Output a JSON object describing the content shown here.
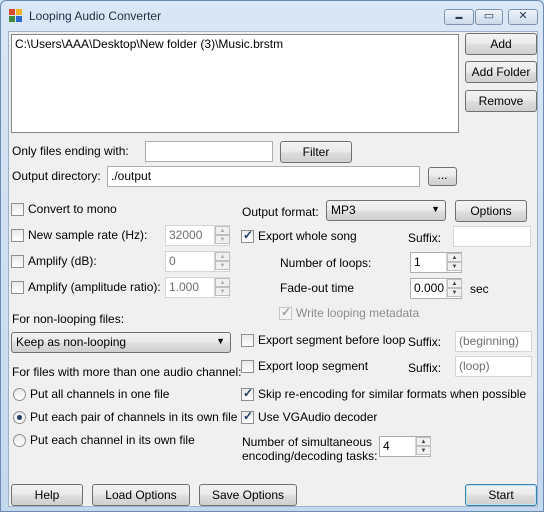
{
  "window": {
    "title": "Looping Audio Converter"
  },
  "files": {
    "items": [
      "C:\\Users\\AAA\\Desktop\\New folder (3)\\Music.brstm"
    ]
  },
  "buttons": {
    "add": "Add",
    "add_folder": "Add Folder",
    "remove": "Remove",
    "filter": "Filter",
    "browse": "...",
    "options": "Options",
    "help": "Help",
    "load_options": "Load Options",
    "save_options": "Save Options",
    "start": "Start"
  },
  "filter": {
    "label": "Only files ending with:",
    "value": ""
  },
  "output_dir": {
    "label": "Output directory:",
    "value": "./output"
  },
  "left": {
    "convert_mono": "Convert to mono",
    "new_sample_rate": "New sample rate (Hz):",
    "sample_rate_value": "32000",
    "amplify_db": "Amplify (dB):",
    "amplify_db_value": "0",
    "amplify_ratio": "Amplify (amplitude ratio):",
    "amplify_ratio_value": "1.000",
    "non_looping_label": "For non-looping files:",
    "non_looping_selected": "Keep as non-looping",
    "multichannel_label": "For files with more than one audio channel:",
    "radio_all": "Put all channels in one file",
    "radio_pair": "Put each pair of channels in its own file",
    "radio_each": "Put each channel in its own file"
  },
  "right": {
    "output_format_label": "Output format:",
    "output_format_selected": "MP3",
    "export_whole": "Export whole song",
    "suffix_label": "Suffix:",
    "whole_suffix": "",
    "loops_label": "Number of loops:",
    "loops_value": "1",
    "fadeout_label": "Fade-out time",
    "fadeout_value": "0.000",
    "fadeout_unit": "sec",
    "write_meta": "Write looping metadata",
    "export_before": "Export segment before loop",
    "before_suffix_placeholder": "(beginning)",
    "export_loop": "Export loop segment",
    "loop_suffix_placeholder": "(loop)",
    "skip_reencode": "Skip re-encoding for similar formats when possible",
    "use_vgaudio": "Use VGAudio decoder",
    "tasks_label_1": "Number of simultaneous",
    "tasks_label_2": "encoding/decoding tasks:",
    "tasks_value": "4"
  }
}
